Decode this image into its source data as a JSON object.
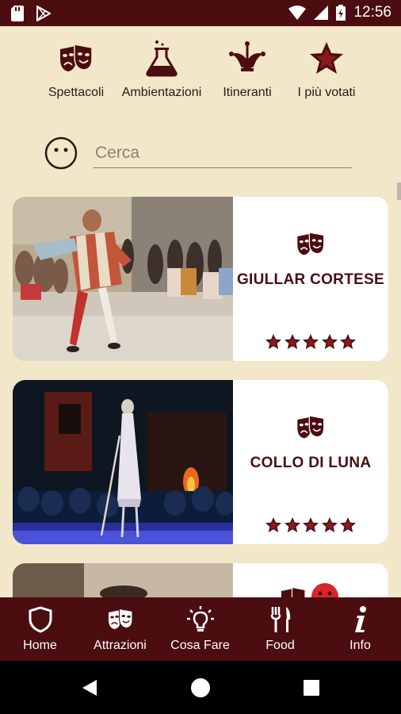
{
  "status_bar": {
    "time": "12:56"
  },
  "categories": [
    {
      "label": "Spettacoli",
      "icon": "theater-masks-icon"
    },
    {
      "label": "Ambientazioni",
      "icon": "flask-icon"
    },
    {
      "label": "Itineranti",
      "icon": "jester-hat-icon"
    },
    {
      "label": "I più votati",
      "icon": "star-icon"
    }
  ],
  "search": {
    "placeholder": "Cerca",
    "value": ""
  },
  "cards": [
    {
      "title": "GIULLAR CORTESE",
      "category_icon": "theater-masks-icon",
      "rating": 5,
      "rating_max": 5
    },
    {
      "title": "COLLO DI LUNA",
      "category_icon": "theater-masks-icon",
      "rating": 5,
      "rating_max": 5
    },
    {
      "title": "",
      "category_icon": "theater-masks-icon",
      "rating": 0,
      "rating_max": 5
    }
  ],
  "bottom_nav": [
    {
      "label": "Home",
      "icon": "shield-icon"
    },
    {
      "label": "Attrazioni",
      "icon": "theater-masks-icon"
    },
    {
      "label": "Cosa Fare",
      "icon": "lightbulb-icon"
    },
    {
      "label": "Food",
      "icon": "fork-knife-icon"
    },
    {
      "label": "Info",
      "icon": "info-icon"
    }
  ],
  "colors": {
    "primary": "#4b0d10",
    "background": "#f2e7c9",
    "card": "#ffffff",
    "accent_red": "#d9262b"
  }
}
